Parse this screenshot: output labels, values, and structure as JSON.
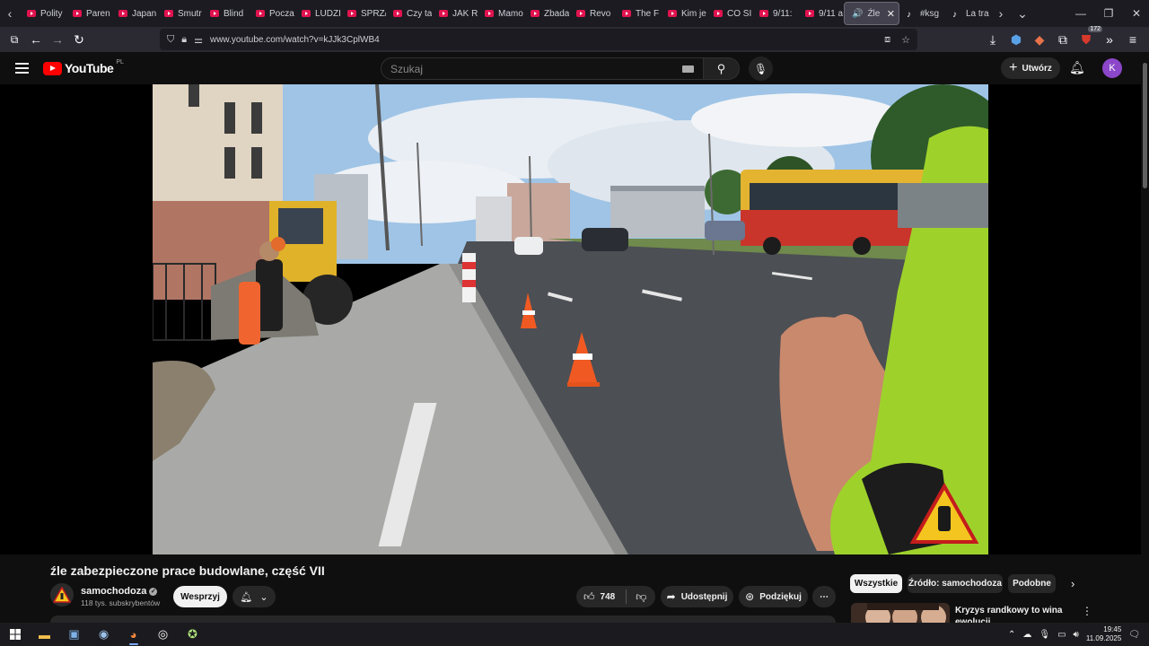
{
  "browser": {
    "tabs": [
      {
        "title": "Polity",
        "type": "youtube"
      },
      {
        "title": "Paren",
        "type": "youtube"
      },
      {
        "title": "Japan",
        "type": "youtube"
      },
      {
        "title": "Smutr",
        "type": "youtube"
      },
      {
        "title": "Blind",
        "type": "youtube"
      },
      {
        "title": "Pocza",
        "type": "youtube"
      },
      {
        "title": "LUDZI",
        "type": "youtube"
      },
      {
        "title": "SPRZ/",
        "type": "youtube"
      },
      {
        "title": "Czy ta",
        "type": "youtube"
      },
      {
        "title": "JAK R",
        "type": "youtube"
      },
      {
        "title": "Mamo",
        "type": "youtube"
      },
      {
        "title": "Zbada",
        "type": "youtube"
      },
      {
        "title": "Revo",
        "type": "youtube"
      },
      {
        "title": "The F",
        "type": "youtube"
      },
      {
        "title": "Kim je",
        "type": "youtube"
      },
      {
        "title": "CO SI",
        "type": "youtube"
      },
      {
        "title": "9/11:",
        "type": "youtube"
      },
      {
        "title": "9/11 a",
        "type": "youtube"
      }
    ],
    "active_tab": {
      "title": "Źle",
      "close": "✕"
    },
    "extra_tabs": [
      {
        "title": "#ksg",
        "type": "tiktok"
      },
      {
        "title": "La tra",
        "type": "tiktok"
      }
    ],
    "url": "www.youtube.com/watch?v=kJJk3CplWB4",
    "extensions_badge": "172"
  },
  "youtube": {
    "logo_text": "YouTube",
    "region": "PL",
    "search_placeholder": "Szukaj",
    "create_label": "Utwórz",
    "avatar_letter": "K"
  },
  "video": {
    "title": "źle zabezpieczone prace budowlane, część VII",
    "channel": "samochodoza",
    "subscribers": "118 tys. subskrybentów",
    "support_label": "Wesprzyj",
    "likes": "748",
    "share_label": "Udostępnij",
    "thanks_label": "Podziękuj"
  },
  "sidebar": {
    "chips": [
      "Wszystkie",
      "Źródło: samochodoza",
      "Podobne"
    ],
    "recommended_title": "Kryzys randkowy to wina ewolucji"
  },
  "taskbar": {
    "time": "19:45",
    "date": "11.09.2025"
  },
  "colors": {
    "youtube_red": "#ff0000",
    "background": "#0f0f0f",
    "avatar": "#8b46c9"
  }
}
